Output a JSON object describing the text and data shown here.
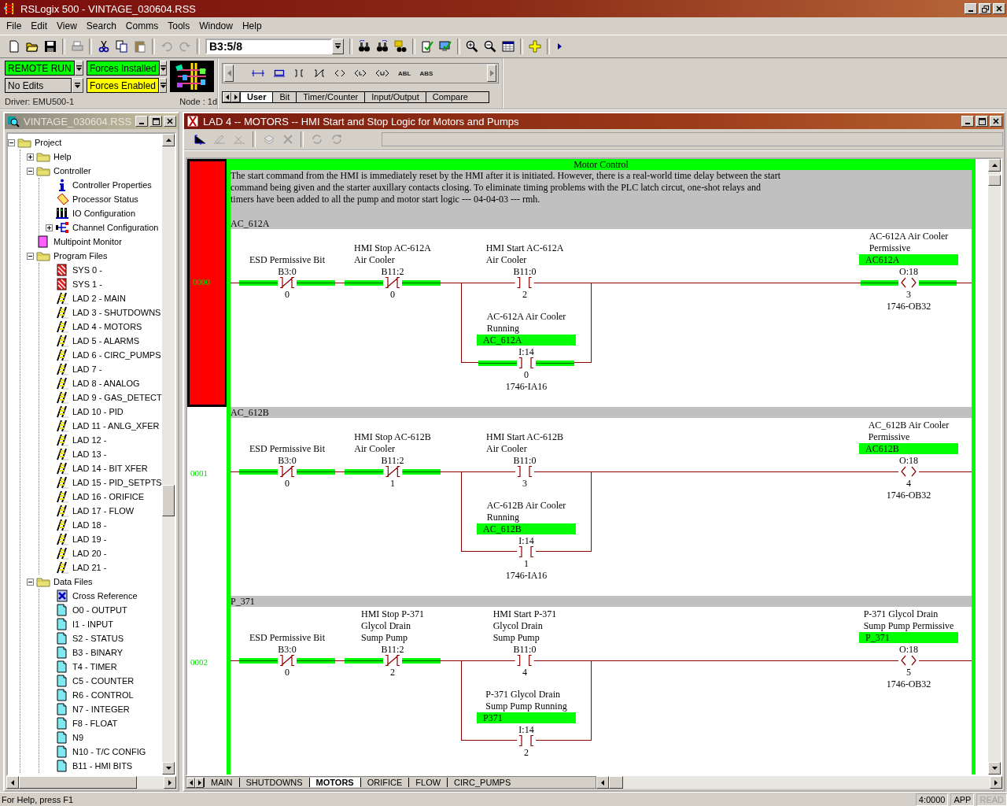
{
  "window": {
    "title": "RSLogix 500 - VINTAGE_030604.RSS"
  },
  "menu": [
    "File",
    "Edit",
    "View",
    "Search",
    "Comms",
    "Tools",
    "Window",
    "Help"
  ],
  "toolbar": {
    "address": "B3:5/8"
  },
  "online": {
    "status_boxes": [
      {
        "label": "REMOTE RUN",
        "color": "#00ff00"
      },
      {
        "label": "Forces Installed",
        "color": "#00ff00"
      },
      {
        "label": "No Edits",
        "color": "#d4d0c8"
      },
      {
        "label": "Forces Enabled",
        "color": "#ffff00"
      }
    ],
    "driver": "Driver: EMU500-1",
    "node": "Node :  1d"
  },
  "palette": {
    "labels": [
      "ABL",
      "ABS"
    ],
    "tabs": [
      {
        "label": "User",
        "selected": true
      },
      {
        "label": "Bit",
        "selected": false
      },
      {
        "label": "Timer/Counter",
        "selected": false
      },
      {
        "label": "Input/Output",
        "selected": false
      },
      {
        "label": "Compare",
        "selected": false
      }
    ]
  },
  "project": {
    "title": "VINTAGE_030604.RSS",
    "tree": [
      {
        "label": "Project",
        "kind": "folder",
        "expanded": true,
        "children": [
          {
            "label": "Help",
            "kind": "folder",
            "expanded": false
          },
          {
            "label": "Controller",
            "kind": "folder",
            "expanded": true,
            "children": [
              {
                "label": "Controller Properties",
                "kind": "info"
              },
              {
                "label": "Processor Status",
                "kind": "status"
              },
              {
                "label": "IO Configuration",
                "kind": "io"
              },
              {
                "label": "Channel Configuration",
                "kind": "channel",
                "expanded": false
              }
            ]
          },
          {
            "label": "Multipoint Monitor",
            "kind": "monitor"
          },
          {
            "label": "Program Files",
            "kind": "folder",
            "expanded": true,
            "children": [
              {
                "label": "SYS 0 -",
                "kind": "sys"
              },
              {
                "label": "SYS 1 -",
                "kind": "sys"
              },
              {
                "label": "LAD 2 - MAIN",
                "kind": "lad"
              },
              {
                "label": "LAD 3 - SHUTDOWNS",
                "kind": "lad"
              },
              {
                "label": "LAD 4 - MOTORS",
                "kind": "lad"
              },
              {
                "label": "LAD 5 - ALARMS",
                "kind": "lad"
              },
              {
                "label": "LAD 6 - CIRC_PUMPS",
                "kind": "lad"
              },
              {
                "label": "LAD 7 -",
                "kind": "lad"
              },
              {
                "label": "LAD 8 - ANALOG",
                "kind": "lad"
              },
              {
                "label": "LAD 9 - GAS_DETECT",
                "kind": "lad"
              },
              {
                "label": "LAD 10 - PID",
                "kind": "lad"
              },
              {
                "label": "LAD 11 - ANLG_XFER",
                "kind": "lad"
              },
              {
                "label": "LAD 12 -",
                "kind": "lad"
              },
              {
                "label": "LAD 13 -",
                "kind": "lad"
              },
              {
                "label": "LAD 14 - BIT XFER",
                "kind": "lad"
              },
              {
                "label": "LAD 15 - PID_SETPTS",
                "kind": "lad"
              },
              {
                "label": "LAD 16 - ORIFICE",
                "kind": "lad"
              },
              {
                "label": "LAD 17 - FLOW",
                "kind": "lad"
              },
              {
                "label": "LAD 18 -",
                "kind": "lad"
              },
              {
                "label": "LAD 19 -",
                "kind": "lad"
              },
              {
                "label": "LAD 20 -",
                "kind": "lad"
              },
              {
                "label": "LAD 21 -",
                "kind": "lad"
              }
            ]
          },
          {
            "label": "Data Files",
            "kind": "folder",
            "expanded": true,
            "children": [
              {
                "label": "Cross Reference",
                "kind": "xref"
              },
              {
                "label": "O0 - OUTPUT",
                "kind": "data"
              },
              {
                "label": "I1 - INPUT",
                "kind": "data"
              },
              {
                "label": "S2 - STATUS",
                "kind": "data"
              },
              {
                "label": "B3 - BINARY",
                "kind": "data"
              },
              {
                "label": "T4 - TIMER",
                "kind": "data"
              },
              {
                "label": "C5 - COUNTER",
                "kind": "data"
              },
              {
                "label": "R6 - CONTROL",
                "kind": "data"
              },
              {
                "label": "N7 - INTEGER",
                "kind": "data"
              },
              {
                "label": "F8 - FLOAT",
                "kind": "data"
              },
              {
                "label": "N9",
                "kind": "data"
              },
              {
                "label": "N10 - T/C CONFIG",
                "kind": "data"
              },
              {
                "label": "B11 - HMI BITS",
                "kind": "data"
              }
            ]
          }
        ]
      }
    ]
  },
  "ladder": {
    "title": "LAD 4 -- MOTORS -- HMI Start and Stop Logic for Motors and Pumps",
    "page_title": "Motor Control",
    "comment": "The start command from the HMI is immediately reset by the HMI after it is initiated. However, there is a real-world time delay between the start\ncommand being given and the starter auxillary contacts closing. To eliminate timing problems with the PLC latch circut, one-shot relays and\ntimers have been added to all the pump and motor start logic --- 04-04-03 --- rmh.",
    "rungs": [
      {
        "number": "0000",
        "selected": true,
        "title": "AC_612A",
        "instructions": [
          {
            "kind": "xio",
            "description": "ESD Permissive Bit",
            "address": "B3:0",
            "bit": "0",
            "energized": true
          },
          {
            "kind": "xio",
            "description": "HMI Stop AC-612A\nAir Cooler",
            "address": "B11:2",
            "bit": "0",
            "energized": true
          },
          {
            "kind": "xic",
            "description": "HMI Start AC-612A\nAir Cooler",
            "address": "B11:0",
            "bit": "2",
            "energized": false
          },
          {
            "kind": "ote",
            "description": "AC-612A Air Cooler\nPermissive",
            "symbol": "AC612A",
            "address": "O:18",
            "bit": "3",
            "module": "1746-OB32",
            "energized": true
          }
        ],
        "branch": [
          {
            "kind": "xic",
            "description": "AC-612A Air Cooler\nRunning",
            "symbol": "AC_612A",
            "address": "I:14",
            "bit": "0",
            "module": "1746-IA16",
            "energized": true
          }
        ]
      },
      {
        "number": "0001",
        "selected": false,
        "title": "AC_612B",
        "instructions": [
          {
            "kind": "xio",
            "description": "ESD Permissive Bit",
            "address": "B3:0",
            "bit": "0",
            "energized": true
          },
          {
            "kind": "xio",
            "description": "HMI Stop AC-612B\nAir Cooler",
            "address": "B11:2",
            "bit": "1",
            "energized": true
          },
          {
            "kind": "xic",
            "description": "HMI Start AC-612B\nAir Cooler",
            "address": "B11:0",
            "bit": "3",
            "energized": false
          },
          {
            "kind": "ote",
            "description": "AC_612B Air Cooler\nPermissive",
            "symbol": "AC612B",
            "address": "O:18",
            "bit": "4",
            "module": "1746-OB32",
            "energized": false
          }
        ],
        "branch": [
          {
            "kind": "xic",
            "description": "AC-612B Air Cooler\nRunning",
            "symbol": "AC_612B",
            "address": "I:14",
            "bit": "1",
            "module": "1746-IA16",
            "energized": false
          }
        ]
      },
      {
        "number": "0002",
        "selected": false,
        "title": "P_371",
        "instructions": [
          {
            "kind": "xio",
            "description": "ESD Permissive Bit",
            "address": "B3:0",
            "bit": "0",
            "energized": true
          },
          {
            "kind": "xio",
            "description": "HMI Stop P-371\nGlycol Drain\nSump Pump",
            "address": "B11:2",
            "bit": "2",
            "energized": true
          },
          {
            "kind": "xic",
            "description": "HMI Start P-371\nGlycol Drain\nSump Pump",
            "address": "B11:0",
            "bit": "4",
            "energized": false
          },
          {
            "kind": "ote",
            "description": "P-371 Glycol Drain\nSump Pump Permissive",
            "symbol": "P_371",
            "address": "O:18",
            "bit": "5",
            "module": "1746-OB32",
            "energized": false
          }
        ],
        "branch": [
          {
            "kind": "xic",
            "description": "P-371 Glycol Drain\nSump Pump Running",
            "symbol": "P371",
            "address": "I:14",
            "bit": "2",
            "energized": false
          }
        ]
      }
    ],
    "file_tabs": [
      {
        "label": "MAIN",
        "selected": false
      },
      {
        "label": "SHUTDOWNS",
        "selected": false
      },
      {
        "label": "MOTORS",
        "selected": true
      },
      {
        "label": "ORIFICE",
        "selected": false
      },
      {
        "label": "FLOW",
        "selected": false
      },
      {
        "label": "CIRC_PUMPS",
        "selected": false
      }
    ]
  },
  "status_bar": {
    "help": "For Help, press F1",
    "position": "4:0000",
    "app": "APP",
    "read": {
      "label": "READ",
      "disabled": true
    }
  }
}
